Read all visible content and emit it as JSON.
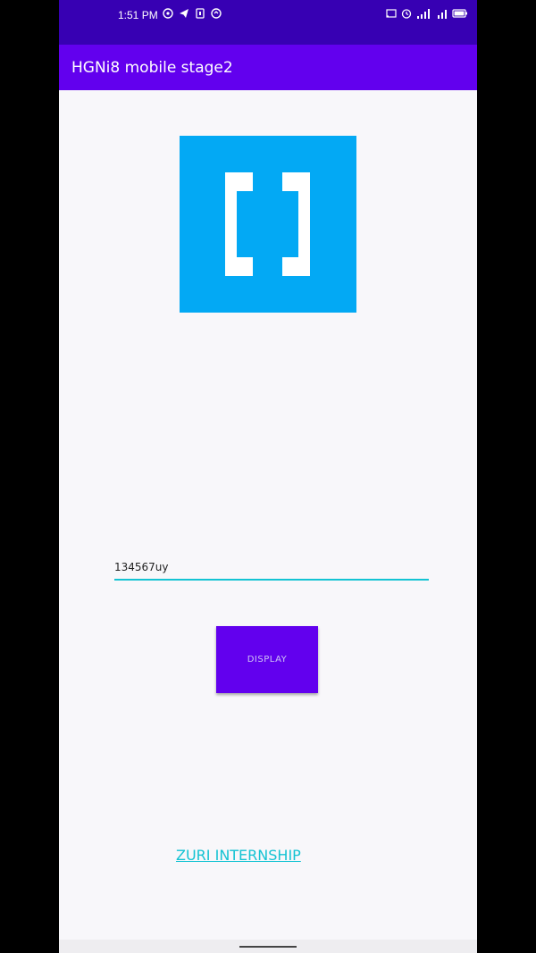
{
  "status_bar": {
    "time": "1:51 PM",
    "left_icons": [
      "whatsapp-icon",
      "telegram-icon",
      "usb-icon",
      "sync-icon"
    ],
    "right_icons": [
      "cast-icon",
      "alarm-icon",
      "signal-icon",
      "signal-icon",
      "battery-icon"
    ]
  },
  "app_bar": {
    "title": "HGNi8 mobile stage2"
  },
  "logo": {
    "icon": "brackets-logo",
    "color": "#03a9f4"
  },
  "input": {
    "value": "134567uy",
    "underline_color": "#14c3d3"
  },
  "button": {
    "label": "DISPLAY",
    "color": "#6200ee"
  },
  "link": {
    "label": "ZURI INTERNSHIP",
    "color": "#14c3d3"
  }
}
